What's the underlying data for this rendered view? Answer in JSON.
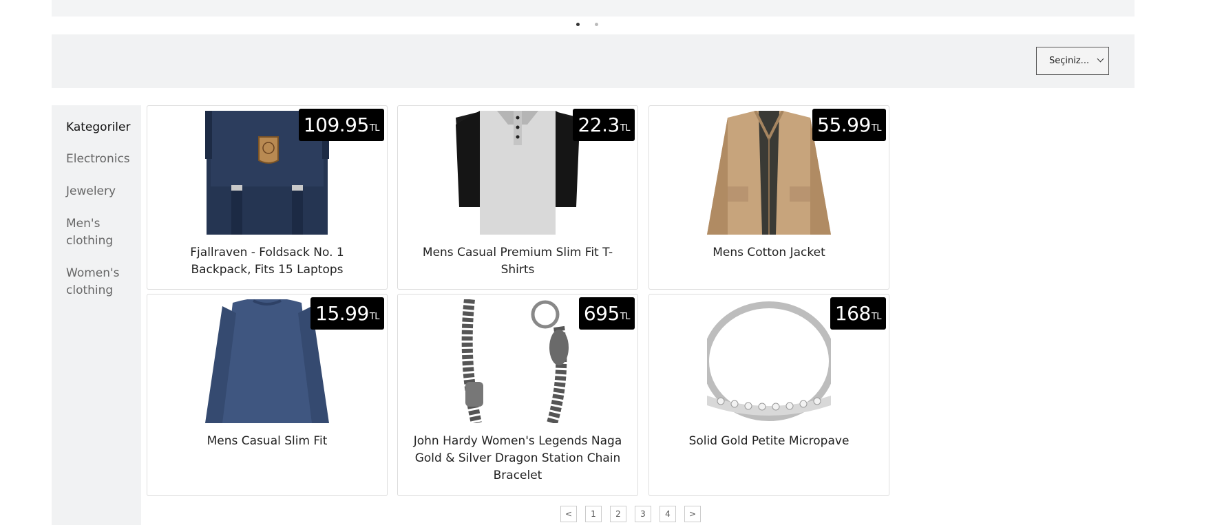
{
  "carousel": {
    "slides": 2,
    "active_slide": 1
  },
  "sort": {
    "selected": "Seçiniz..."
  },
  "sidebar": {
    "title": "Kategoriler",
    "items": [
      {
        "label": "Electronics"
      },
      {
        "label": "Jewelery"
      },
      {
        "label": "Men's clothing"
      },
      {
        "label": "Women's clothing"
      }
    ]
  },
  "currency": "TL",
  "products": [
    {
      "title": "Fjallraven - Foldsack No. 1 Backpack, Fits 15 Laptops",
      "price": "109.95",
      "image": "backpack"
    },
    {
      "title": "Mens Casual Premium Slim Fit T-Shirts",
      "price": "22.3",
      "image": "tshirt"
    },
    {
      "title": "Mens Cotton Jacket",
      "price": "55.99",
      "image": "jacket"
    },
    {
      "title": "Mens Casual Slim Fit",
      "price": "15.99",
      "image": "longsleeve"
    },
    {
      "title": "John Hardy Women's Legends Naga Gold & Silver Dragon Station Chain Bracelet",
      "price": "695",
      "image": "bracelet"
    },
    {
      "title": "Solid Gold Petite Micropave",
      "price": "168",
      "image": "ring"
    }
  ],
  "pagination": {
    "prev": "<",
    "pages": [
      "1",
      "2",
      "3",
      "4"
    ],
    "next": ">"
  },
  "colors": {
    "price_badge_bg": "#000000",
    "sidebar_bg": "#f1f2f3"
  }
}
